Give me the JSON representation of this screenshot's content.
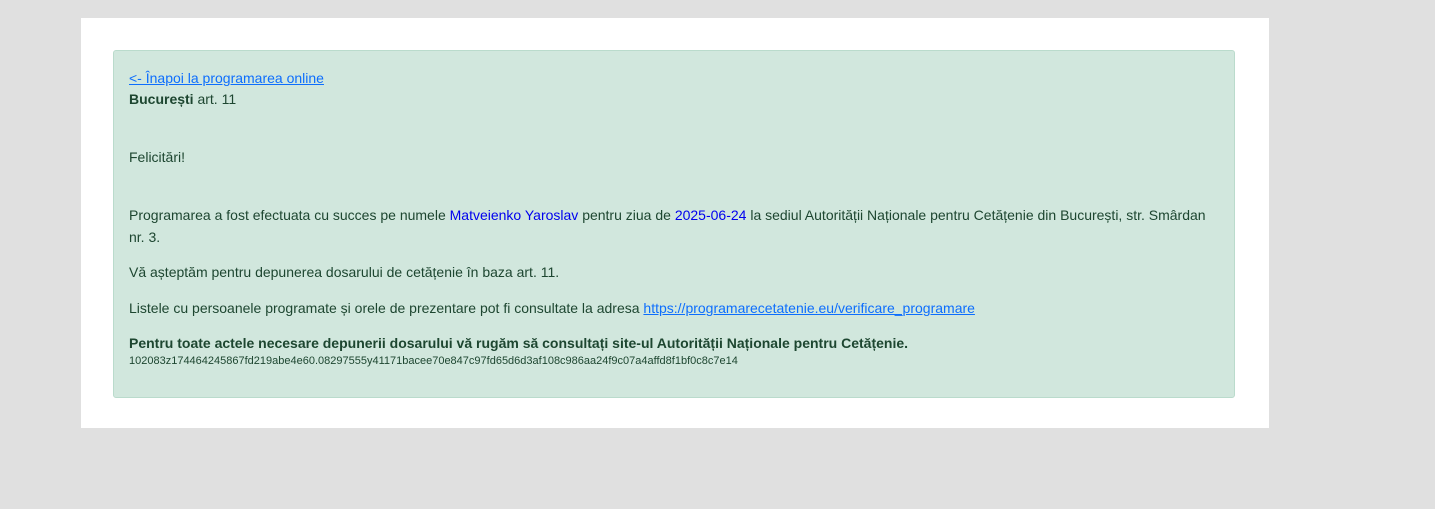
{
  "back_link": "<- Înapoi la programarea online",
  "city": {
    "name": "București",
    "article": "art. 11"
  },
  "greeting": "Felicitări!",
  "confirmation": {
    "prefix": "Programarea a fost efectuata cu succes pe numele",
    "name": "Matveienko Yaroslav",
    "middle": "pentru ziua de",
    "date": "2025-06-24",
    "suffix": "la sediul Autorității Naționale pentru Cetățenie din București, str. Smârdan nr. 3."
  },
  "waiting_text": "Vă așteptăm pentru depunerea dosarului de cetățenie în baza art. 11.",
  "lists": {
    "text": "Listele cu persoanele programate și orele de prezentare pot fi consultate la adresa",
    "url": "https://programarecetatenie.eu/verificare_programare"
  },
  "notice": "Pentru toate actele necesare depunerii dosarului vă rugăm să consultați site-ul Autorității Naționale pentru Cetățenie.",
  "hash": "102083z174464245867fd219abe4e60.08297555y41171bacee70e847c97fd65d6d3af108c986aa24f9c07a4affd8f1bf0c8c7e14",
  "colors": {
    "alert_bg": "#d1e7dd",
    "text": "#1d4630",
    "link": "#0d6efd",
    "highlight": "#0000ee"
  }
}
